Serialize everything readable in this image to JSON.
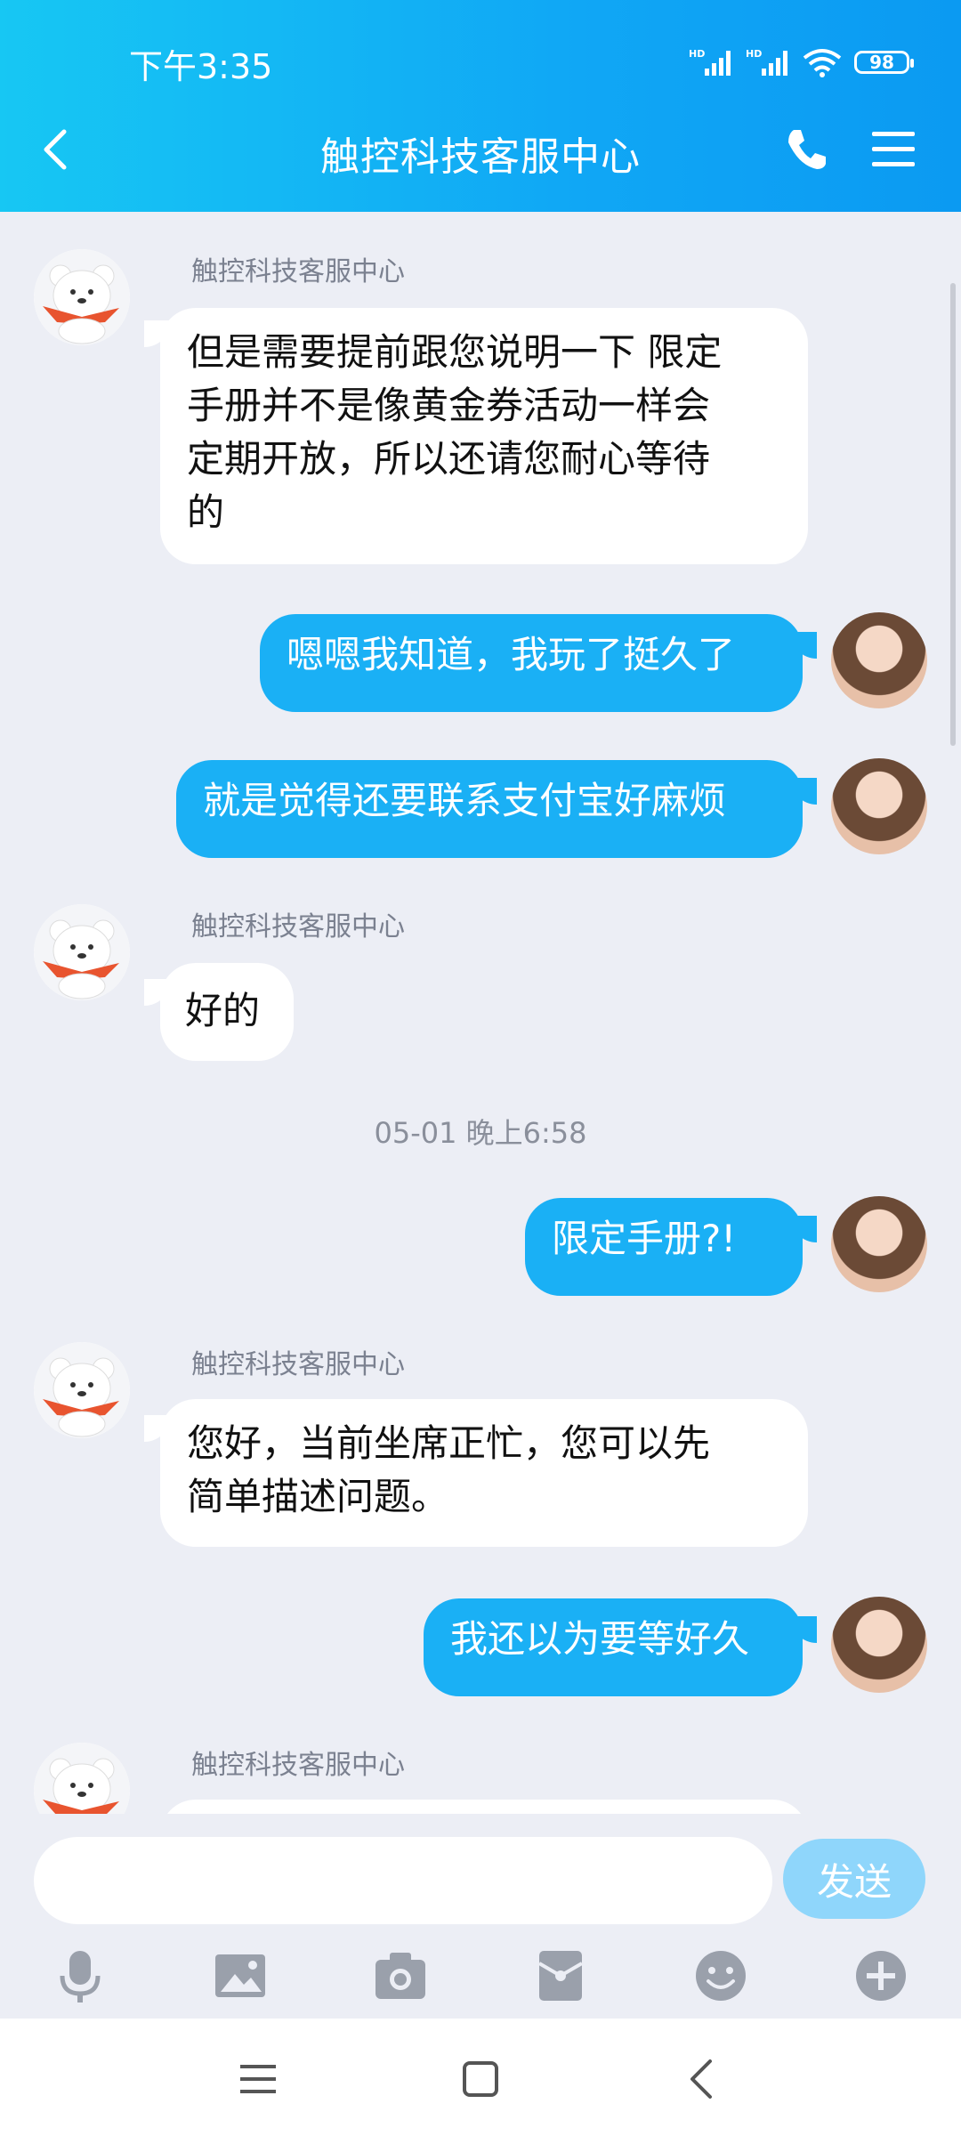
{
  "status": {
    "time": "下午3:35",
    "battery": "98"
  },
  "header": {
    "title": "触控科技客服中心"
  },
  "messages": [
    {
      "type": "in",
      "sender": "触控科技客服中心",
      "text": "但是需要提前跟您说明一下 限定\n手册并不是像黄金券活动一样会\n定期开放，所以还请您耐心等待\n的"
    },
    {
      "type": "out",
      "text": "嗯嗯我知道，我玩了挺久了"
    },
    {
      "type": "out",
      "text": "就是觉得还要联系支付宝好麻烦"
    },
    {
      "type": "in",
      "sender": "触控科技客服中心",
      "text": "好的"
    },
    {
      "type": "timestamp",
      "text": "05-01 晚上6:58"
    },
    {
      "type": "out",
      "text": "限定手册?!"
    },
    {
      "type": "in",
      "sender": "触控科技客服中心",
      "text": "您好，当前坐席正忙，您可以先\n简单描述问题。"
    },
    {
      "type": "out",
      "text": "我还以为要等好久"
    },
    {
      "type": "in",
      "sender": "触控科技客服中心",
      "text": ""
    }
  ],
  "input": {
    "value": "",
    "send_label": "发送"
  },
  "toolbar": [
    "microphone-icon",
    "image-icon",
    "camera-icon",
    "red-packet-icon",
    "emoji-icon",
    "add-icon"
  ],
  "colors": {
    "accent": "#1ab0f5",
    "header_start": "#17c7f3",
    "header_end": "#0b9af2",
    "background": "#eceef5"
  }
}
